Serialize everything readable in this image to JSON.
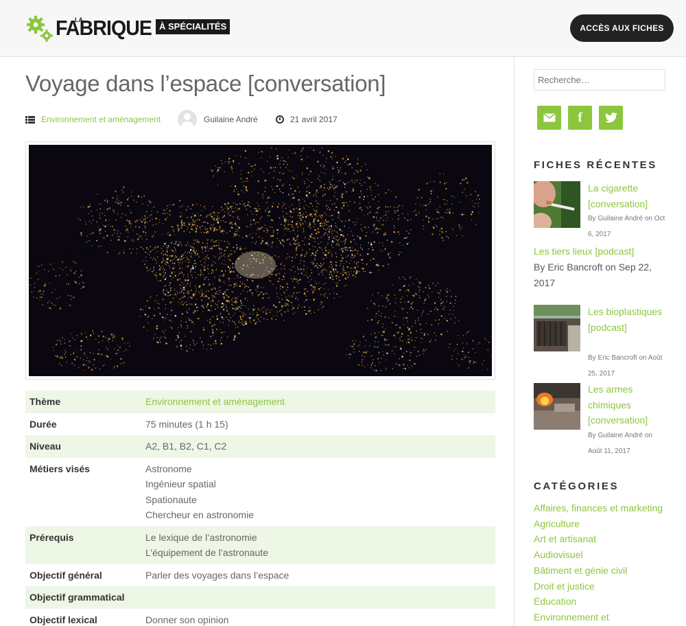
{
  "header": {
    "logo": {
      "la": "LA",
      "fabrique": "FABRIQUE",
      "tag": "À SPÉCIALITÉS"
    },
    "cta_label": "ACCÈS AUX FICHES"
  },
  "post": {
    "title": "Voyage dans l’espace [conversation]",
    "category": "Environnement et aménagement",
    "author": "Guilaine André",
    "date": "21 avril 2017",
    "hero_icon": "night-city-photo"
  },
  "details": [
    {
      "key": "Thème",
      "value": [
        "Environnement et aménagement"
      ],
      "link": true
    },
    {
      "key": "Durée",
      "value": [
        "75 minutes (1 h 15)"
      ]
    },
    {
      "key": "Niveau",
      "value": [
        "A2, B1, B2, C1, C2"
      ]
    },
    {
      "key": "Métiers visés",
      "value": [
        "Astronome",
        "Ingénieur spatial",
        "Spationaute",
        "Chercheur en astronomie"
      ]
    },
    {
      "key": "Prérequis",
      "value": [
        "Le lexique de l’astronomie",
        "L’équipement de l’astronaute"
      ]
    },
    {
      "key": "Objectif général",
      "value": [
        "Parler des voyages dans l’espace"
      ]
    },
    {
      "key": "Objectif grammatical",
      "value": []
    },
    {
      "key": "Objectif lexical",
      "value": [
        "Donner son opinion"
      ]
    }
  ],
  "sidebar": {
    "search_placeholder": "Recherche…",
    "social": [
      {
        "name": "email-icon",
        "glyph": "✉"
      },
      {
        "name": "facebook-icon",
        "glyph": "f"
      },
      {
        "name": "twitter-icon",
        "glyph": "t"
      }
    ],
    "recent_heading": "FICHES RÉCENTES",
    "recent": [
      {
        "title": "La cigarette [conversation]",
        "meta": "By Guilaine André on Oct 6, 2017"
      },
      {
        "title": "Les tiers lieux [podcast]",
        "meta": "By Eric Bancroft on Sep 22, 2017"
      },
      {
        "title": "Les bioplastiques [podcast]",
        "meta": "By Eric Bancroft on Août 25, 2017"
      },
      {
        "title": "Les armes chimiques [conversation]",
        "meta": "By Guilaine André on Août 11, 2017"
      }
    ],
    "categories_heading": "CATÉGORIES",
    "categories": [
      "Affaires, finances et marketing",
      "Agriculture",
      "Art et artisanat",
      "Audiovisuel",
      "Bâtiment et génie civil",
      "Droit et justice",
      "Éducation",
      "Environnement et"
    ]
  },
  "colors": {
    "accent": "#8cc63f",
    "dark": "#222222",
    "row_alt": "#eef6e6"
  }
}
